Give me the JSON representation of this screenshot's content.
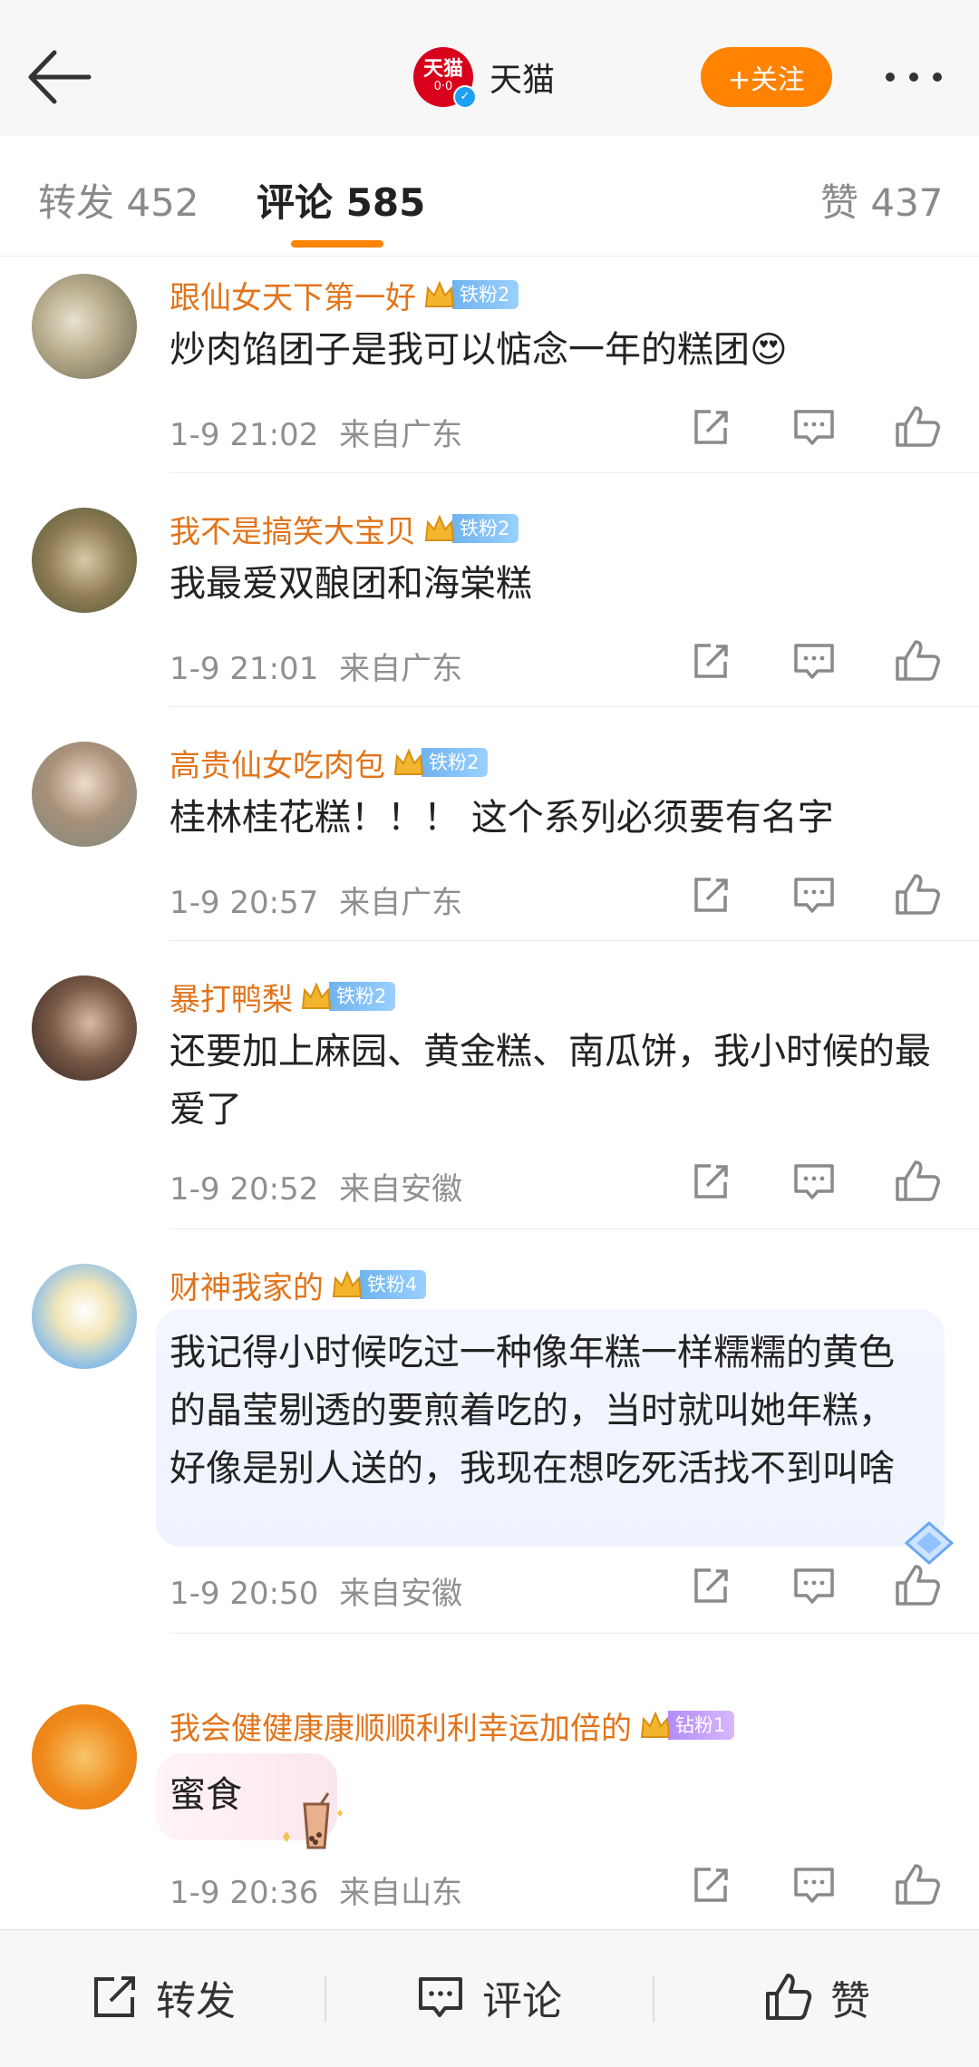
{
  "header": {
    "account_name": "天猫",
    "avatar_line1": "天猫",
    "avatar_line2": "0·0",
    "follow_label": "+关注"
  },
  "tabs": {
    "repost": "转发 452",
    "comment": "评论 585",
    "like": "赞 437"
  },
  "comments": [
    {
      "name": "跟仙女天下第一好",
      "badge": "铁粉2",
      "text": "炒肉馅团子是我可以惦念一年的糕团😍",
      "time": "1-9 21:02",
      "location": "来自广东"
    },
    {
      "name": "我不是搞笑大宝贝",
      "badge": "铁粉2",
      "text": "我最爱双酿团和海棠糕",
      "time": "1-9 21:01",
      "location": "来自广东"
    },
    {
      "name": "高贵仙女吃肉包",
      "badge": "铁粉2",
      "text": "桂林桂花糕！！！ 这个系列必须要有名字",
      "time": "1-9 20:57",
      "location": "来自广东"
    },
    {
      "name": "暴打鸭梨",
      "badge": "铁粉2",
      "text": "还要加上麻园、黄金糕、南瓜饼，我小时候的最爱了",
      "time": "1-9 20:52",
      "location": "来自安徽"
    },
    {
      "name": "财神我家的",
      "badge": "铁粉4",
      "text": "我记得小时候吃过一种像年糕一样糯糯的黄色的晶莹剔透的要煎着吃的，当时就叫她年糕，好像是别人送的，我现在想吃死活找不到叫啥",
      "time": "1-9 20:50",
      "location": "来自安徽"
    },
    {
      "name": "我会健健康康顺顺利利幸运加倍的",
      "badge": "钻粉1",
      "text": "蜜食",
      "time": "1-9 20:36",
      "location": "来自山东"
    }
  ],
  "bottom_bar": {
    "repost": "转发",
    "comment": "评论",
    "like": "赞"
  },
  "colors": {
    "accent": "#ff8200",
    "username": "#e2741b",
    "fan_badge": "#6fb3ee",
    "diamond_badge": "#b48cf5"
  },
  "icons": {
    "back": "back-arrow-icon",
    "more": "more-dots-icon",
    "share": "share-icon",
    "comment": "comment-icon",
    "like": "thumbs-up-icon",
    "crown": "crown-icon"
  }
}
